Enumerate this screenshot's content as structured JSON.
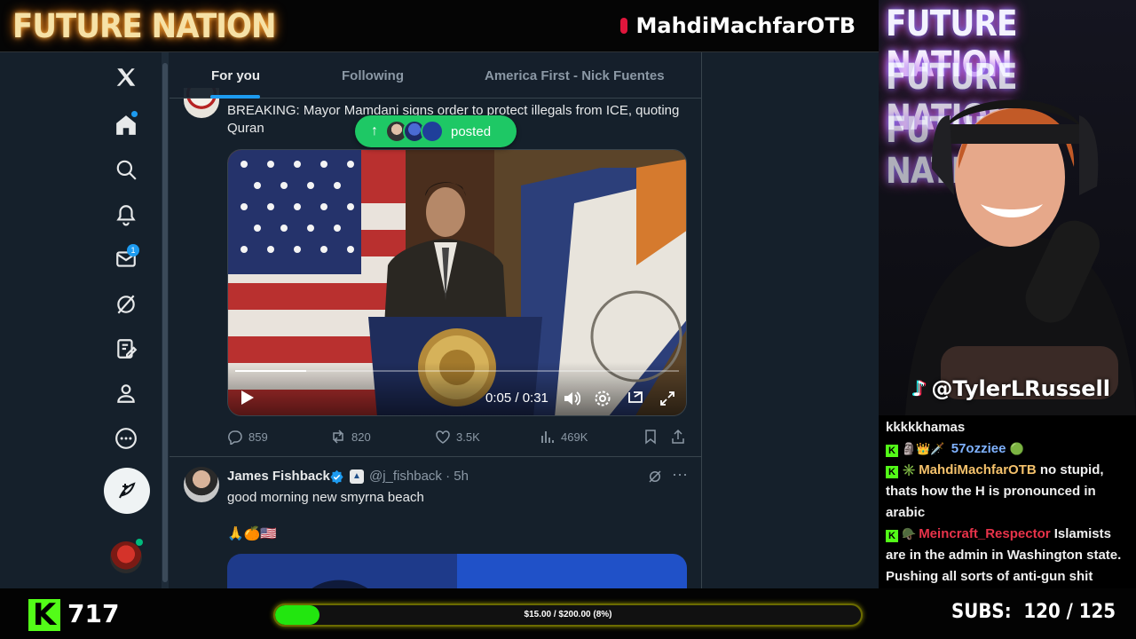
{
  "overlay": {
    "brand_title": "FUTURE NATION",
    "streamer_handle": "MahdiMachfarOTB",
    "tiktok_handle": "@TylerLRussell",
    "kick_viewers": "717",
    "goal_text": "$15.00 / $200.00 (8%)",
    "goal_progress": 0.075,
    "subs_label": "SUBS:",
    "subs_value": "120 / 125"
  },
  "nav": {
    "messages_badge": "1"
  },
  "tabs": [
    {
      "label": "For you",
      "active": true
    },
    {
      "label": "Following",
      "active": false
    },
    {
      "label": "America First - Nick Fuentes",
      "active": false
    }
  ],
  "new_posts_pill": {
    "arrow": "↑",
    "label": "posted"
  },
  "tweet1": {
    "text": "BREAKING: Mayor Mamdani signs order to protect illegals from ICE, quoting Quran",
    "video_time": "0:05 / 0:31",
    "video_progress": 0.16,
    "replies": "859",
    "reposts": "820",
    "likes": "3.5K",
    "views": "469K"
  },
  "tweet2": {
    "name": "James Fishback",
    "handle_time": "@j_fishback · 5h",
    "text": "good morning new smyrna beach",
    "emoji": "🙏🍊🇺🇸"
  },
  "chat": [
    {
      "user": "",
      "user_color": "#ffffff",
      "message": "kkkkkhamas",
      "badges": ""
    },
    {
      "user": "57ozziee",
      "user_color": "#7fb2ff",
      "message": "",
      "badges": "K 🗿👑🗡️"
    },
    {
      "user": "MahdiMachfarOTB",
      "user_color": "#f4c16b",
      "message": "no stupid, thats how the H is pronounced in arabic",
      "badges": "K ✳️"
    },
    {
      "user": "Meincraft_Respector",
      "user_color": "#e8334a",
      "message": "Islamists are in the admin in Washington state. Pushing all sorts of anti-gun shit",
      "badges": "K 🪖"
    }
  ],
  "colors": {
    "x_bg": "#15202b",
    "x_blue": "#1d9bf0",
    "kick_green": "#53fc18",
    "posted_green": "#1ec865"
  },
  "icons": [
    "x-logo-icon",
    "home-icon",
    "search-icon",
    "bell-icon",
    "mail-icon",
    "grok-icon",
    "compose-list-icon",
    "profile-icon",
    "more-icon",
    "post-feather-icon"
  ]
}
